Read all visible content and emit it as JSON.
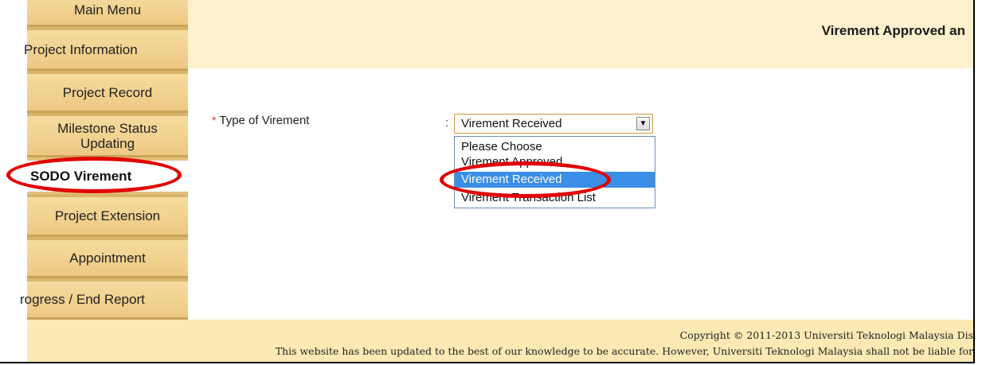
{
  "sidebar": {
    "items": [
      {
        "label": "Main Menu"
      },
      {
        "label": "Project Information"
      },
      {
        "label": "Project Record"
      },
      {
        "label": "Milestone Status Updating"
      },
      {
        "label": "SODO Virement"
      },
      {
        "label": "Project Extension"
      },
      {
        "label": "Appointment"
      },
      {
        "label": "rogress / End Report"
      }
    ]
  },
  "header": {
    "title": "Virement Approved an"
  },
  "form": {
    "required_mark": "*",
    "label": "Type of Virement",
    "colon": ":",
    "selected_value": "Virement Received",
    "options": [
      {
        "label": "Please Choose"
      },
      {
        "label": "Virement Approved"
      },
      {
        "label": "Virement Received"
      },
      {
        "label": "Virement Transaction List"
      }
    ]
  },
  "footer": {
    "copyright": "Copyright © 2011-2013 Universiti Teknologi Malaysia Dis",
    "disclaimer": "This website has been updated to the best of our knowledge to be accurate. However, Universiti Teknologi Malaysia shall not be liable for"
  },
  "colors": {
    "sidebar_bg": "#edc883",
    "header_bg": "#fdf0cc",
    "footer_bg": "#fde9b4",
    "highlight_ring": "#e10000",
    "option_selected": "#3a8ee6"
  }
}
